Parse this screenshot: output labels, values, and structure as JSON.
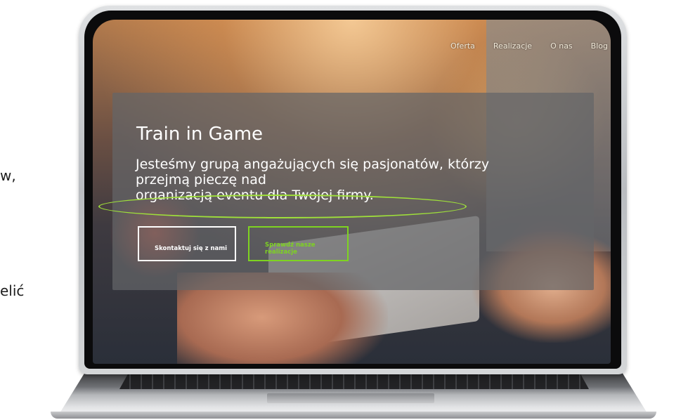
{
  "background_text": {
    "line1": "w,",
    "line2": "elić"
  },
  "site": {
    "nav": [
      "Oferta",
      "Realizacje",
      "O nas",
      "Blog"
    ],
    "hero": {
      "title": "Train in Game",
      "description_lines": [
        "Jesteśmy grupą angażujących się pasjonatów, którzy",
        "przejmą pieczę nad",
        "organizacją eventu dla Twojej firmy."
      ],
      "buttons": {
        "contact": "Skontaktuj się z nami",
        "portfolio": "Sprawdź nasze realizacje"
      }
    }
  },
  "colors": {
    "accent_green": "#7ed321",
    "panel": "#646568"
  }
}
